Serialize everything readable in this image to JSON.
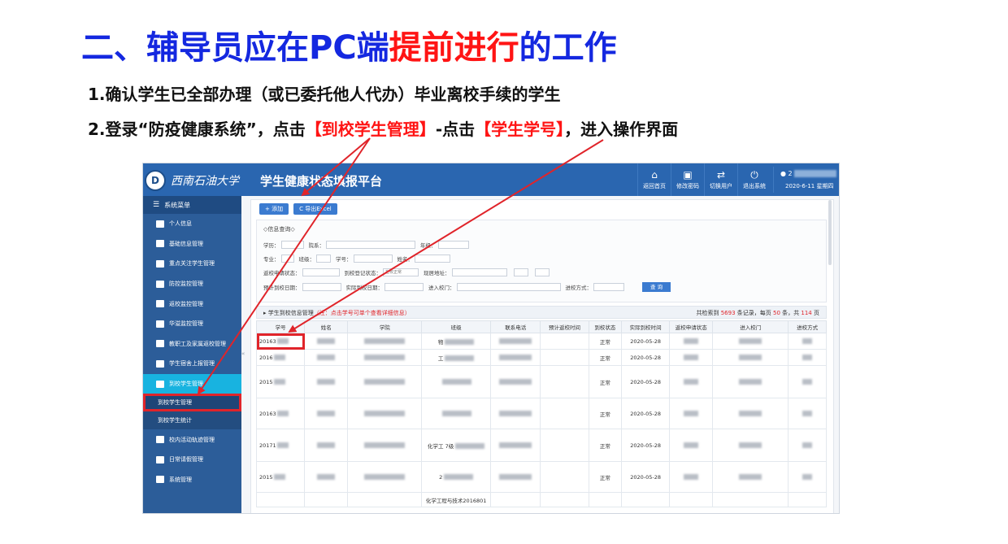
{
  "slide": {
    "title_part1": "二、辅导员应在PC端",
    "title_highlight": "提前进行",
    "title_part2": "的工作",
    "step1": "1.确认学生已全部办理（或已委托他人代办）毕业离校手续的学生",
    "step2_a": "2.登录“防疫健康系统”，点击",
    "step2_red1": "【到校学生管理】",
    "step2_b": "-点击",
    "step2_red2": "【学生学号】",
    "step2_c": "，进入操作界面"
  },
  "app": {
    "logo_text": "西南石油大学",
    "title": "学生健康状态填报平台",
    "nav": [
      {
        "label": "返回首页",
        "icon": "home-icon",
        "glyph": "⌂"
      },
      {
        "label": "修改密码",
        "icon": "lock-icon",
        "glyph": "🔒"
      },
      {
        "label": "切换用户",
        "icon": "switch-icon",
        "glyph": "⇄"
      },
      {
        "label": "退出系统",
        "icon": "power-icon",
        "glyph": "⏻"
      }
    ],
    "user_prefix": "2",
    "date": "2020-6-11 星期四"
  },
  "sidebar": {
    "header": "系统菜单",
    "items": [
      "个人信息",
      "基础信息管理",
      "重点关注学生管理",
      "防控监控管理",
      "返校监控管理",
      "华溢监控管理",
      "教职工及家属返校管理",
      "学生宿舍上报管理",
      "到校学生管理"
    ],
    "sub_items": [
      "到校学生管理",
      "到校学生统计"
    ],
    "items_after": [
      "校内活动轨迹管理",
      "日常请假管理",
      "系统管理"
    ]
  },
  "toolbar": {
    "add": "+ 添加",
    "export": "C 导出Excel"
  },
  "query": {
    "title": "◇信息查询◇",
    "row1": [
      "学历：",
      "院系：",
      "年级："
    ],
    "row2": [
      "专业：",
      "班级：",
      "学号：",
      "姓名："
    ],
    "row3_a": "返校申请状态：",
    "row3_b": "到校登记状态：",
    "row3_b_value": "在校正常",
    "row3_c": "现居地址：",
    "row4": [
      "预计到校日期：",
      "实际到校日期：",
      "进入校门："
    ],
    "row4_d": "进校方式：",
    "search": "查 询"
  },
  "table": {
    "caption_prefix": "▸ 学生到校信息管理",
    "caption_note": "（注：点击学号可单个查看详细信息）",
    "pager_a": "共检索到",
    "total": "5693",
    "pager_b": "条记录，每页",
    "per_page": "50",
    "pager_c": "条，共",
    "pages": "114",
    "pager_d": "页",
    "columns": [
      "学号",
      "姓名",
      "学院",
      "班级",
      "联系电话",
      "预计返校时间",
      "到校状态",
      "实际到校时间",
      "返校申请状态",
      "进入校门",
      "进校方式"
    ],
    "rows": [
      {
        "id": "20163",
        "status": "正常",
        "date": "2020-05-28",
        "cls": "物"
      },
      {
        "id": "2016",
        "status": "正常",
        "date": "2020-05-28",
        "cls": "工"
      },
      {
        "id": "2015",
        "status": "正常",
        "date": "2020-05-28",
        "cls": ""
      },
      {
        "id": "20163",
        "status": "正常",
        "date": "2020-05-28",
        "cls": ""
      },
      {
        "id": "20171",
        "status": "正常",
        "date": "2020-05-28",
        "cls": "化学工 7级"
      },
      {
        "id": "2015",
        "status": "正常",
        "date": "2020-05-28",
        "cls": "2"
      },
      {
        "id": "",
        "status": "",
        "date": "",
        "cls": "化学工程与技术2016801"
      }
    ]
  }
}
